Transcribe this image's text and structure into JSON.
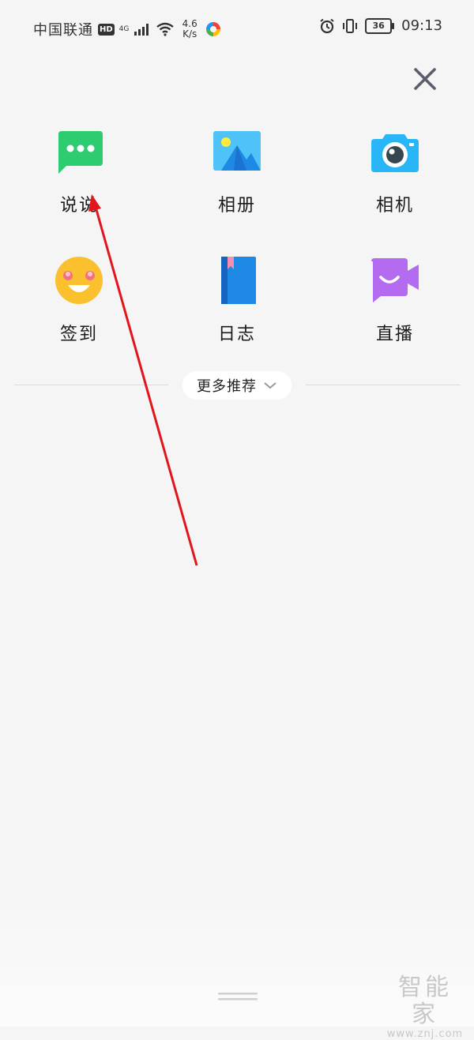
{
  "status_bar": {
    "carrier": "中国联通",
    "hd_badge": "HD",
    "network_type": "4G",
    "speed_value": "4.6",
    "speed_unit": "K/s",
    "battery": "36",
    "time": "09:13"
  },
  "actions": [
    {
      "label": "说说",
      "icon": "chat-bubble-icon",
      "color": "#2ecc71"
    },
    {
      "label": "相册",
      "icon": "photo-album-icon",
      "color": "#3fb6f0"
    },
    {
      "label": "相机",
      "icon": "camera-icon",
      "color": "#29b6f6"
    },
    {
      "label": "签到",
      "icon": "smiley-icon",
      "color": "#fbc02d"
    },
    {
      "label": "日志",
      "icon": "journal-book-icon",
      "color": "#1e88e5"
    },
    {
      "label": "直播",
      "icon": "live-video-icon",
      "color": "#b36bf0"
    }
  ],
  "more": {
    "label": "更多推荐",
    "icon": "chevron-down-icon"
  },
  "close": {
    "icon": "close-icon"
  },
  "annotation": {
    "color": "#e0161c"
  },
  "watermark": {
    "main": "智能家",
    "url": "www.znj.com"
  }
}
